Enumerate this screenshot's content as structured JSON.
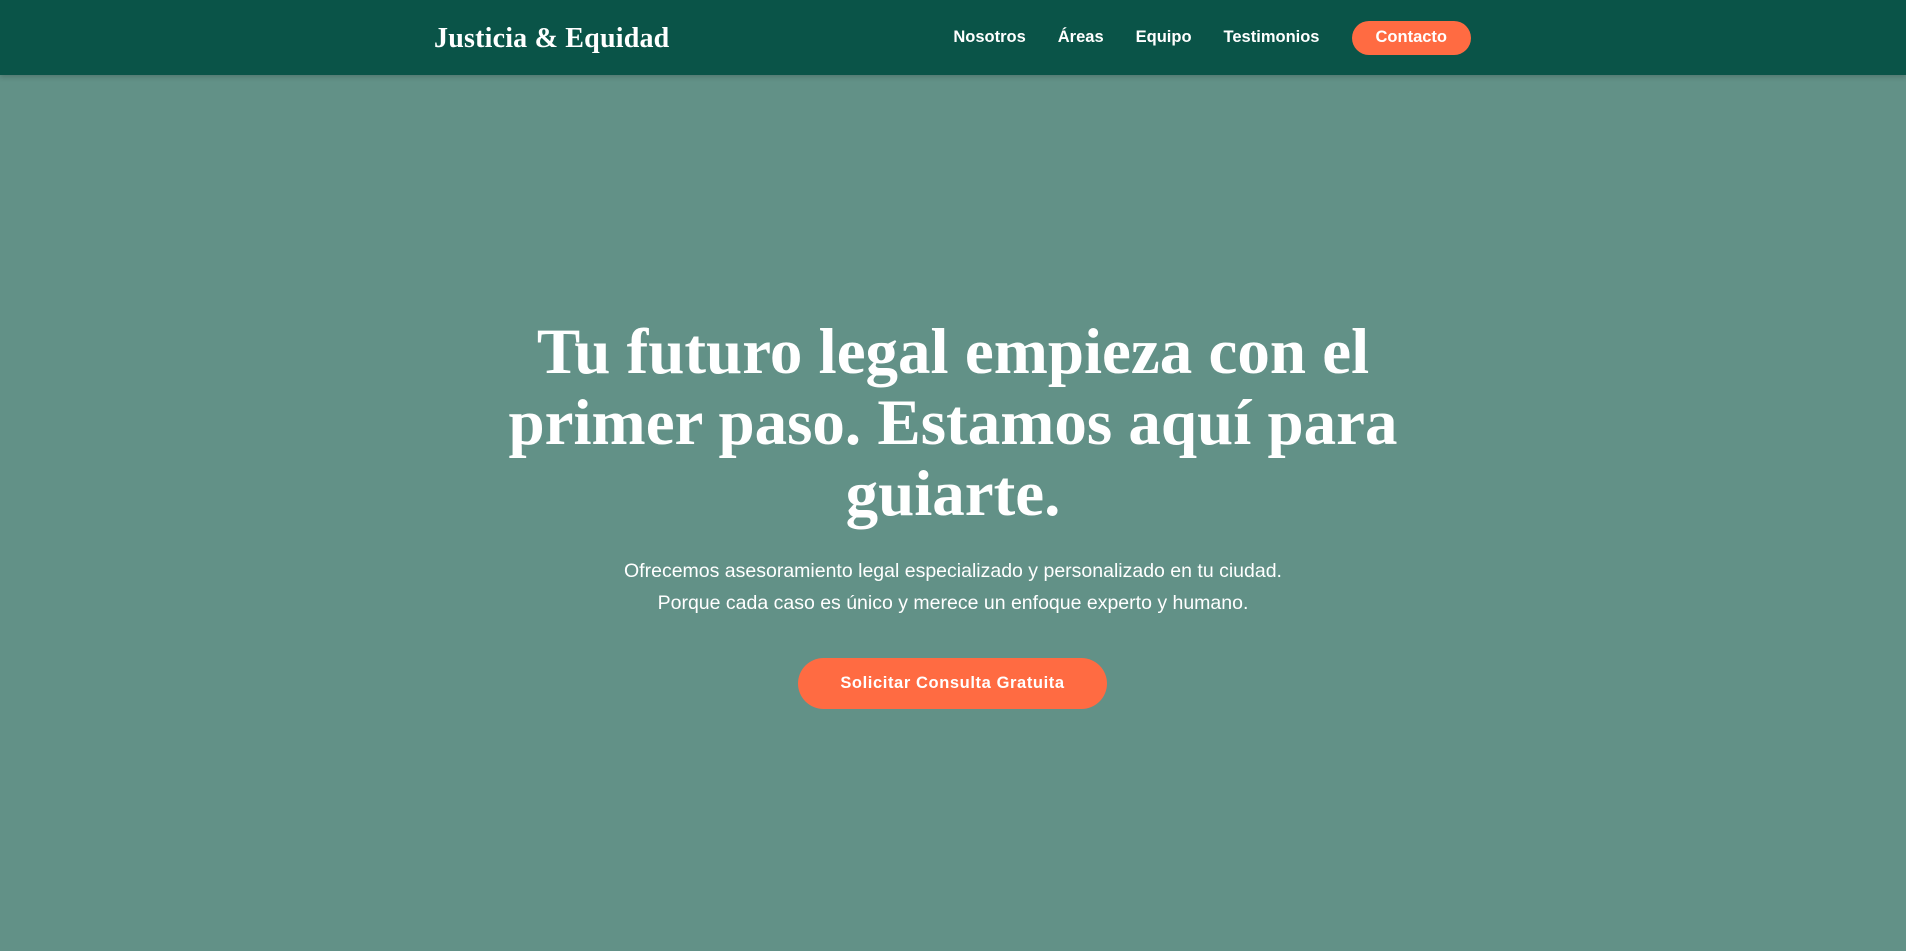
{
  "header": {
    "brand": "Justicia & Equidad",
    "nav": [
      {
        "label": "Nosotros"
      },
      {
        "label": "Áreas"
      },
      {
        "label": "Equipo"
      },
      {
        "label": "Testimonios"
      }
    ],
    "cta_label": "Contacto"
  },
  "hero": {
    "title": "Tu futuro legal empieza con el primer paso. Estamos aquí para guiarte.",
    "subtitle_line1": "Ofrecemos asesoramiento legal especializado y personalizado en tu ciudad.",
    "subtitle_line2": "Porque cada caso es único y merece un enfoque experto y humano.",
    "button_label": "Solicitar Consulta Gratuita"
  },
  "colors": {
    "header_bg": "#0a5448",
    "hero_bg": "#629187",
    "accent": "#ff6b42",
    "text": "#ffffff"
  }
}
